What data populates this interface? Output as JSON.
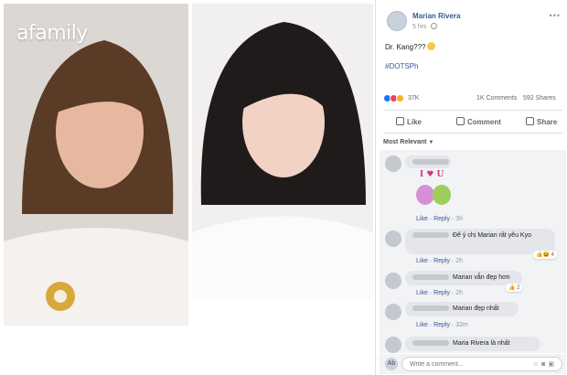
{
  "brand": {
    "logo_text": "afamily"
  },
  "post": {
    "author": "Marian Rivera",
    "time": "5 hrs",
    "text": "Dr. Kang???",
    "hashtag": "#DOTSPh",
    "reactions_count": "37K",
    "comments_count": "1K Comments",
    "shares_count": "592 Shares"
  },
  "actions": {
    "like": "Like",
    "comment": "Comment",
    "share": "Share"
  },
  "sort": {
    "label": "Most Relevant"
  },
  "comments": [
    {
      "text": "",
      "like": "Like",
      "reply": "Reply",
      "time": "3h",
      "sticker_text": "I ♥ U"
    },
    {
      "text": "Để ý chị Marian rất yêu Kyo",
      "like": "Like",
      "reply": "Reply",
      "time": "2h",
      "reactions": "4"
    },
    {
      "text": "Marian vẫn đẹp hơn",
      "like": "Like",
      "reply": "Reply",
      "time": "2h",
      "reactions": "2"
    },
    {
      "text": "Marian đẹp nhất",
      "like": "Like",
      "reply": "Reply",
      "time": "32m"
    },
    {
      "text": "Maria Rivera là nhất"
    }
  ],
  "composer": {
    "avatar_letter": "Ab",
    "placeholder": "Write a comment..."
  },
  "colors": {
    "link": "#385898",
    "meta": "#90949c",
    "bubble": "#e4e6eb"
  },
  "icons": [
    "globe-icon",
    "more-icon",
    "like-icon",
    "comment-icon",
    "share-icon",
    "chevron-down-icon"
  ]
}
